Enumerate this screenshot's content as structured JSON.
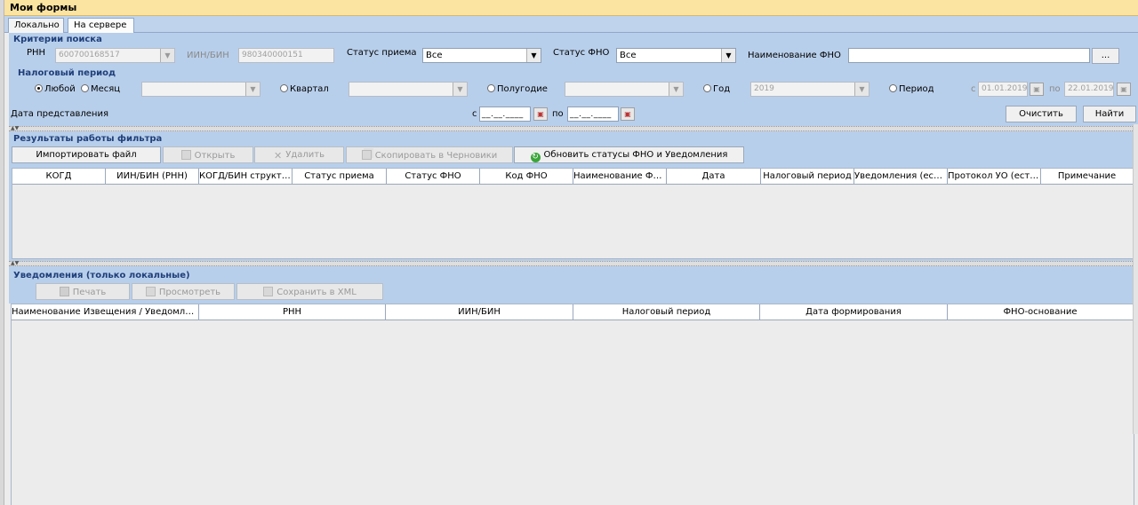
{
  "window": {
    "title": "Мои формы"
  },
  "tabs": [
    {
      "label": "Локально"
    },
    {
      "label": "На сервере"
    }
  ],
  "search": {
    "title": "Критерии поиска",
    "rnn": {
      "label": "РНН",
      "value": "600700168517"
    },
    "iin": {
      "label": "ИИН/БИН",
      "value": "980340000151"
    },
    "status_priema": {
      "label": "Статус приема",
      "value": "Все"
    },
    "status_fno": {
      "label": "Статус ФНО",
      "value": "Все"
    },
    "naimenovanie": {
      "label": "Наименование ФНО",
      "value": "",
      "browse_label": "..."
    },
    "period_title": "Налоговый период",
    "period": {
      "any": "Любой",
      "month": "Месяц",
      "quarter": "Квартал",
      "halfyear": "Полугодие",
      "year": "Год",
      "year_value": "2019",
      "range": "Период",
      "from_label": "с",
      "from_value": "01.01.2019",
      "to_label": "по",
      "to_value": "22.01.2019"
    },
    "date_pred": {
      "label": "Дата представления",
      "from_label": "с",
      "from_mask": "__.__.____",
      "to_label": "по",
      "to_mask": "__.__.____"
    },
    "clear_label": "Очистить",
    "find_label": "Найти"
  },
  "results": {
    "title": "Результаты работы фильтра",
    "toolbar": {
      "import": "Импортировать файл",
      "open": "Открыть",
      "delete": "Удалить",
      "copy": "Скопировать в Черновики",
      "refresh": "Обновить статусы ФНО и Уведомления"
    },
    "columns": [
      "КОГД",
      "ИИН/БИН (РНН)",
      "КОГД/БИН структур...",
      "Статус приема",
      "Статус ФНО",
      "Код ФНО",
      "Наименование ФНО",
      "Дата",
      "Налоговый период",
      "Уведомления (есть...",
      "Протокол УО (есть/...",
      "Примечание"
    ]
  },
  "notices": {
    "title": "Уведомления (только локальные)",
    "toolbar": {
      "print": "Печать",
      "view": "Просмотреть",
      "save_xml": "Сохранить в XML"
    },
    "columns": [
      "Наименование Извещения / Уведомлени...",
      "РНН",
      "ИИН/БИН",
      "Налоговый период",
      "Дата формирования",
      "ФНО-основание"
    ]
  },
  "icons": {
    "calendar": "calendar-icon",
    "dropdown": "chevron-down-icon",
    "refresh": "refresh-icon"
  },
  "colors": {
    "title_bar": "#fbe3a1",
    "panel": "#b8cfeb",
    "section_title": "#1f3f7a"
  }
}
